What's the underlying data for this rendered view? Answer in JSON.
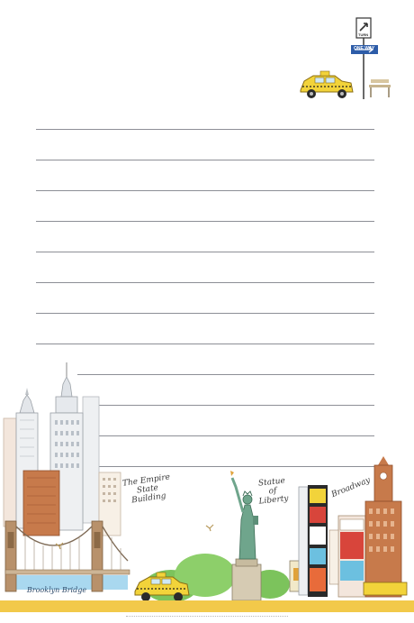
{
  "labels": {
    "empire": [
      "The Empire",
      "State",
      "Building"
    ],
    "liberty": [
      "Statue",
      "of",
      "Liberty"
    ],
    "broadway": "Broadway",
    "bridge": "Brooklyn Bridge"
  },
  "signs": {
    "one_way": "ONE WAY",
    "turn": "TURN"
  },
  "ruled_lines": 12,
  "colors": {
    "line": "#8d8f96",
    "taxi": "#f2d33a",
    "greenery": "#7cc35c",
    "brick": "#c77a4b",
    "liberty_green": "#6fa58c",
    "bridge": "#b8916b",
    "water": "#a9d8ef"
  }
}
